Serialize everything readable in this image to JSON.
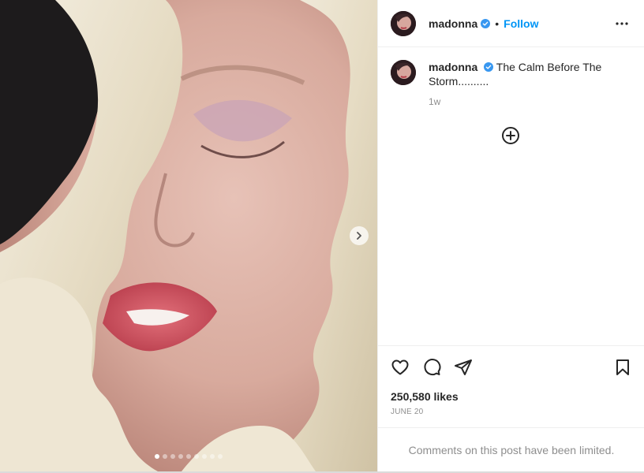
{
  "post": {
    "username": "madonna",
    "separator": "•",
    "follow_label": "Follow",
    "caption": "The Calm Before The Storm..........",
    "time_ago": "1w",
    "likes": "250,580 likes",
    "date": "JUNE 20",
    "comments_notice": "Comments on this post have been limited.",
    "carousel": {
      "total": 9,
      "active_index": 1
    }
  },
  "icons": {
    "verified": "verified-badge-icon",
    "more": "more-options-icon",
    "add": "plus-circle-icon",
    "like": "heart-icon",
    "comment": "comment-icon",
    "share": "share-icon",
    "save": "bookmark-icon",
    "next": "chevron-right-icon"
  },
  "colors": {
    "accent": "#0095f6",
    "text": "#262626",
    "muted": "#8e8e8e",
    "border": "#efefef"
  }
}
